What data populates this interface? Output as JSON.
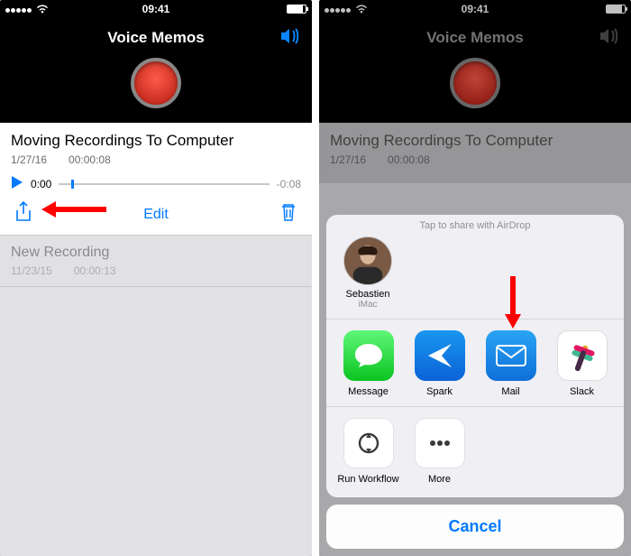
{
  "status": {
    "time": "09:41",
    "wifi": "wifi-icon"
  },
  "app": {
    "title": "Voice Memos"
  },
  "recording": {
    "title": "Moving Recordings To Computer",
    "date": "1/27/16",
    "duration": "00:00:08",
    "elapsed": "0:00",
    "remaining": "-0:08",
    "edit_label": "Edit"
  },
  "list": {
    "item": {
      "title": "New Recording",
      "date": "11/23/15",
      "duration": "00:00:13"
    }
  },
  "share": {
    "airdrop_hint": "Tap to share with AirDrop",
    "contact": {
      "name": "Sebastien",
      "device": "iMac"
    },
    "apps": {
      "message": "Message",
      "spark": "Spark",
      "mail": "Mail",
      "slack": "Slack"
    },
    "actions": {
      "run_workflow": "Run Workflow",
      "more": "More"
    },
    "cancel": "Cancel"
  }
}
